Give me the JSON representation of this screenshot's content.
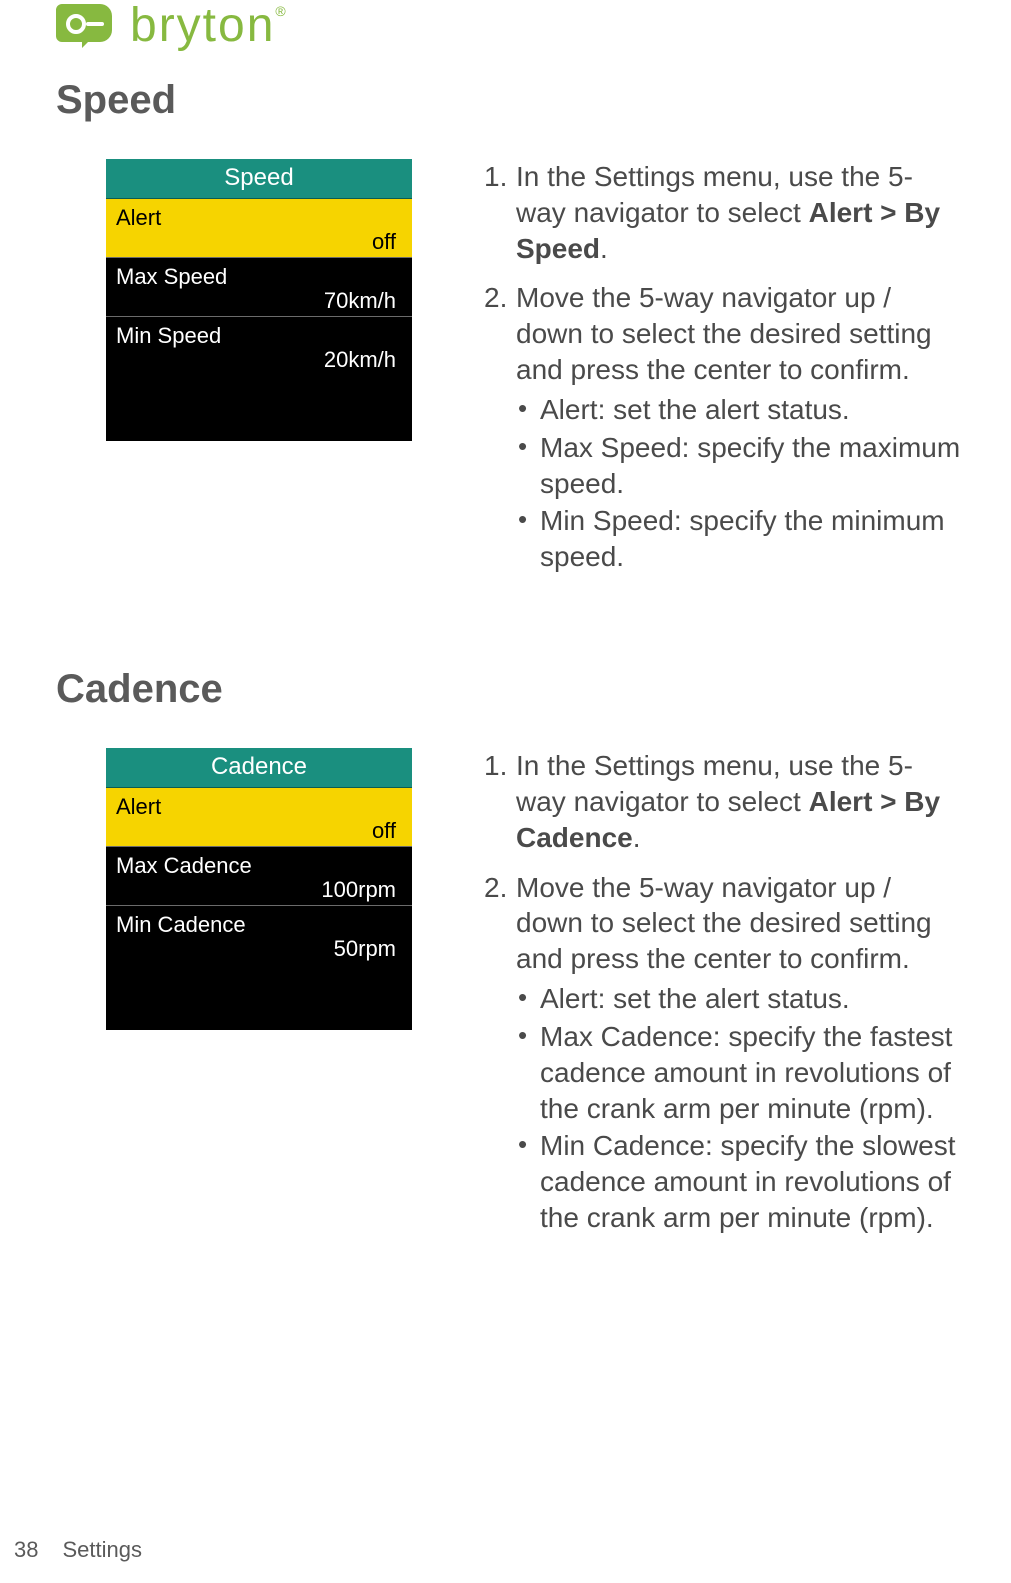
{
  "brand": {
    "name": "bryton"
  },
  "footer": {
    "page_number": "38",
    "section": "Settings"
  },
  "sections": {
    "speed": {
      "title": "Speed",
      "device": {
        "title": "Speed",
        "rows": [
          {
            "label": "Alert",
            "value": "off"
          },
          {
            "label": "Max Speed",
            "value": "70km/h"
          },
          {
            "label": "Min Speed",
            "value": "20km/h"
          }
        ]
      },
      "steps": {
        "s1_pre": "In the Settings menu, use the 5-way navigator to select ",
        "s1_bold": "Alert > By Speed",
        "s1_post": ".",
        "s2": "Move the 5-way navigator up / down to select the desired setting and press the center to confirm.",
        "bullets": [
          "Alert: set the alert status.",
          "Max Speed: specify the maximum speed.",
          "Min Speed: specify the minimum speed."
        ]
      }
    },
    "cadence": {
      "title": "Cadence",
      "device": {
        "title": "Cadence",
        "rows": [
          {
            "label": "Alert",
            "value": "off"
          },
          {
            "label": "Max Cadence",
            "value": "100rpm"
          },
          {
            "label": "Min Cadence",
            "value": "50rpm"
          }
        ]
      },
      "steps": {
        "s1_pre": "In the Settings menu, use the 5-way navigator to select ",
        "s1_bold": "Alert > By Cadence",
        "s1_post": ".",
        "s2": "Move the 5-way navigator up / down to select the desired setting and press the center to confirm.",
        "bullets": [
          "Alert: set the alert status.",
          "Max Cadence: specify the fastest cadence amount in revolutions of the crank arm per minute (rpm).",
          "Min Cadence: specify the slowest cadence amount in revolutions of the crank arm per minute (rpm)."
        ]
      }
    }
  }
}
